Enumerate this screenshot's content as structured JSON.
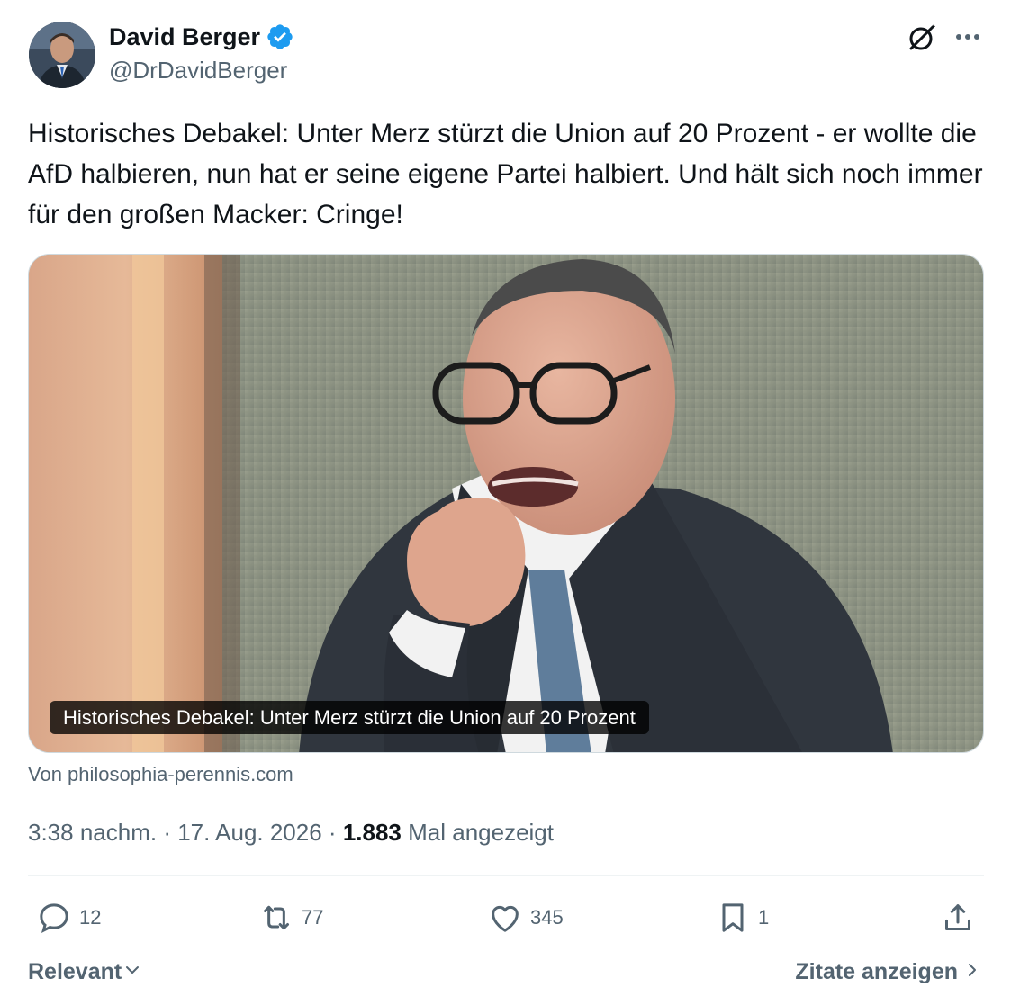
{
  "author": {
    "name": "David Berger",
    "handle": "@DrDavidBerger",
    "verified": true,
    "verified_color": "#1d9bf0"
  },
  "header_icons": [
    "grok-icon",
    "more-icon"
  ],
  "tweet": {
    "text": "Historisches Debakel: Unter Merz stürzt die Union auf 20 Prozent - er wollte die AfD halbieren, nun hat er seine eigene Partei halbiert. Und hält sich noch immer für den großen Macker: Cringe!"
  },
  "link_card": {
    "caption": "Historisches Debakel: Unter Merz stürzt die Union auf 20 Prozent",
    "source": "Von philosophia-perennis.com"
  },
  "meta": {
    "time": "3:38 nachm.",
    "separator": "·",
    "date": "17. Aug. 2026",
    "views_count": "1.883",
    "views_label": "Mal angezeigt"
  },
  "actions": {
    "reply_count": "12",
    "retweet_count": "77",
    "like_count": "345",
    "bookmark_count": "1"
  },
  "footer": {
    "sort_label": "Relevant",
    "quotes_label": "Zitate anzeigen"
  },
  "colors": {
    "text_primary": "#0f1419",
    "text_secondary": "#536471",
    "divider": "#eff3f4",
    "accent": "#1d9bf0"
  }
}
